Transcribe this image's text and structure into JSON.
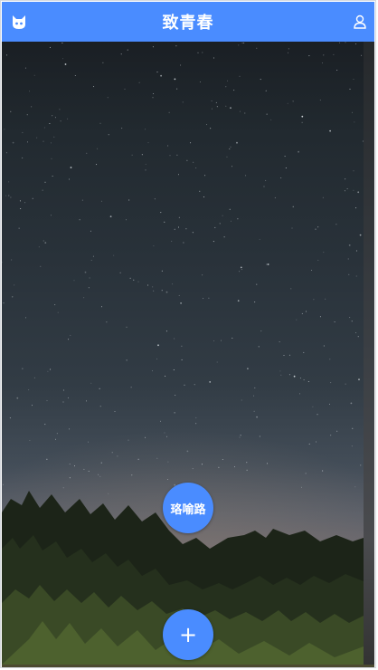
{
  "header": {
    "title": "致青春",
    "left_icon": "cat-logo-icon",
    "right_icon": "user-icon"
  },
  "main": {
    "location_button": "珞喻路",
    "add_button": "+",
    "background": "night-sky-forest-image"
  },
  "colors": {
    "accent": "#4a8cff",
    "sky_top": "#1a1f24",
    "sky_horizon": "#6e6a6f",
    "trees": "#2c3a22"
  }
}
